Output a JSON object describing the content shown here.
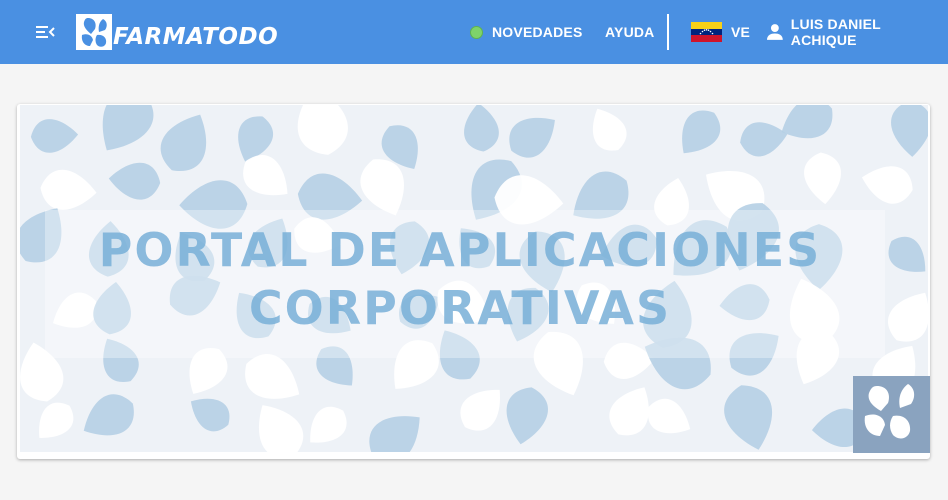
{
  "header": {
    "brand": "FARMATODO",
    "nav": {
      "novedades": "NOVEDADES",
      "ayuda": "AYUDA",
      "country": "VE",
      "user": "LUIS DANIEL ACHIQUE"
    }
  },
  "banner": {
    "title_line1": "PORTAL DE APLICACIONES",
    "title_line2": "CORPORATIVAS"
  },
  "colors": {
    "topbar": "#4a90e2",
    "novedades_dot": "#7ed36a",
    "banner_drops": "#b5cfe4",
    "banner_title": "#78afd7"
  },
  "icons": [
    "menu-collapse-icon",
    "farmatodo-logo-icon",
    "status-dot-icon",
    "venezuela-flag-icon",
    "user-icon"
  ]
}
